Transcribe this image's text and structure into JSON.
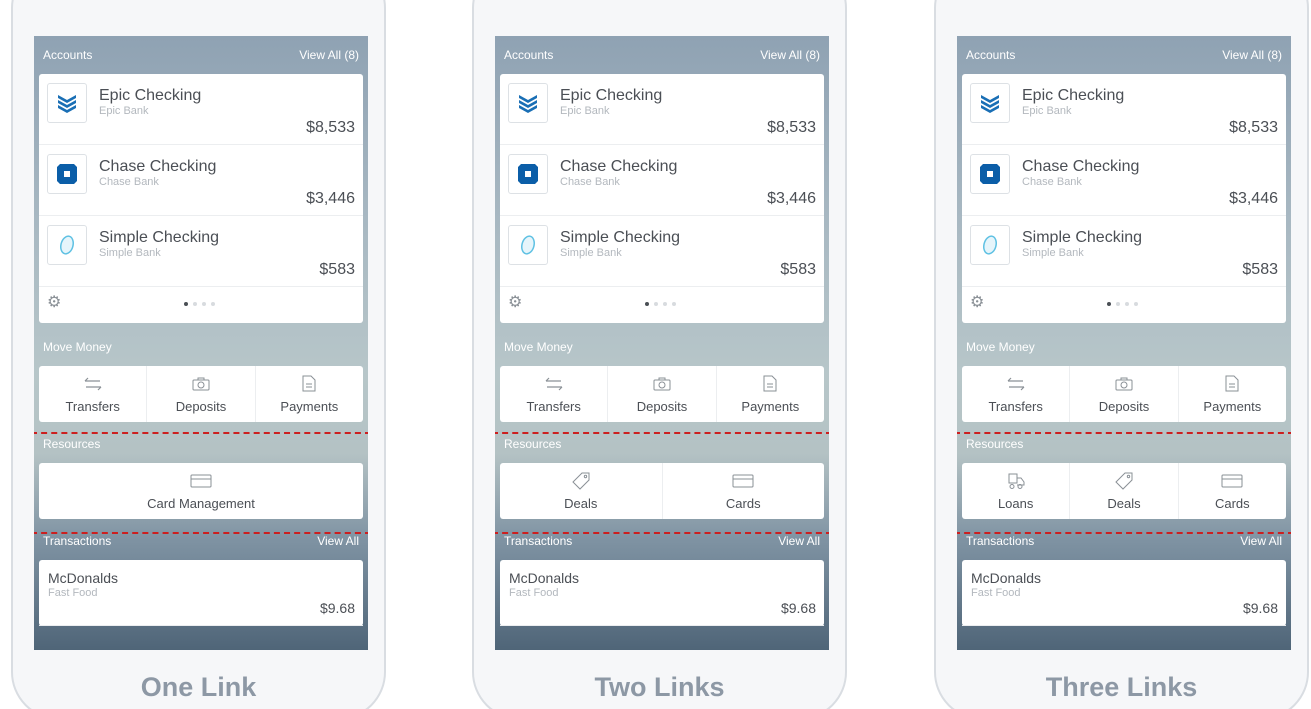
{
  "colors": {
    "accent_blue": "#1a6fb5",
    "highlight_frame": "#cc1f1f",
    "label_gray": "#8d98a5"
  },
  "accounts": {
    "title": "Accounts",
    "view_all": "View All  (8)",
    "items": [
      {
        "name": "Epic Checking",
        "bank": "Epic Bank",
        "amount": "$8,533",
        "icon": "epic-bank-logo-icon"
      },
      {
        "name": "Chase Checking",
        "bank": "Chase Bank",
        "amount": "$3,446",
        "icon": "chase-bank-logo-icon"
      },
      {
        "name": "Simple Checking",
        "bank": "Simple Bank",
        "amount": "$583",
        "icon": "simple-bank-logo-icon"
      }
    ],
    "page_dots": 4,
    "active_page": 1
  },
  "move_money": {
    "title": "Move Money",
    "buttons": [
      {
        "label": "Transfers",
        "icon": "transfer-arrows-icon"
      },
      {
        "label": "Deposits",
        "icon": "camera-icon"
      },
      {
        "label": "Payments",
        "icon": "document-icon"
      }
    ]
  },
  "resources_title": "Resources",
  "transactions": {
    "title": "Transactions",
    "view_all": "View All",
    "items": [
      {
        "name": "McDonalds",
        "category": "Fast Food",
        "amount": "$9.68"
      }
    ]
  },
  "variants": [
    {
      "label": "One Link",
      "resources": [
        {
          "label": "Card Management",
          "icon": "credit-card-icon"
        }
      ]
    },
    {
      "label": "Two Links",
      "resources": [
        {
          "label": "Deals",
          "icon": "tag-icon"
        },
        {
          "label": "Cards",
          "icon": "credit-card-icon"
        }
      ]
    },
    {
      "label": "Three Links",
      "resources": [
        {
          "label": "Loans",
          "icon": "truck-icon"
        },
        {
          "label": "Deals",
          "icon": "tag-icon"
        },
        {
          "label": "Cards",
          "icon": "credit-card-icon"
        }
      ]
    }
  ]
}
